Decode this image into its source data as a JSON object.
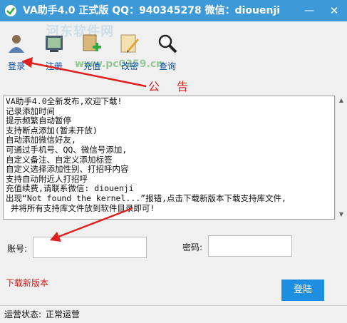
{
  "window": {
    "title": "VA助手4.0 正式版 QQ：940345278 微信：diouenji",
    "minimize_glyph": "—",
    "close_glyph": "✕"
  },
  "watermark": {
    "text": "河东软件网",
    "url": "www.pc0359.cn"
  },
  "toolbar": {
    "items": [
      {
        "label": "登录",
        "icon": "login-icon"
      },
      {
        "label": "注册",
        "icon": "register-icon"
      },
      {
        "label": "充值",
        "icon": "recharge-icon"
      },
      {
        "label": "改密",
        "icon": "change-password-icon"
      },
      {
        "label": "查询",
        "icon": "query-icon"
      }
    ]
  },
  "notice": {
    "title": "公告",
    "text": "VA助手4.0全新发布,欢迎下载!\n记录添加时间\n提示频繁自动暂停\n支持断点添加(暂未开放)\n自动添加微信好友,\n可通过手机号、QQ、微信号添加,\n自定义备注、自定义添加标签\n自定义选择添加性别、打招呼内容\n支持自动附近人打招呼\n充值续费,请联系微信: diouenji\n出现“Not found the kernel...”报错,点击下载新版本下载支持库文件,\n 并将所有支持库文件放到软件目录即可!"
  },
  "form": {
    "account_label": "账号:",
    "account_value": "",
    "password_label": "密码:",
    "password_value": ""
  },
  "download_link": "下载新版本",
  "login_button": "登陆",
  "status": {
    "label": "运营状态:",
    "value": "正常运营"
  },
  "colors": {
    "titlebar": "#3d99d8",
    "toolbar_label": "#0a4fa8",
    "notice_title": "#e02020",
    "download_link": "#d01818",
    "login_button": "#1e8fe0",
    "annotation_arrow": "#e02020"
  }
}
